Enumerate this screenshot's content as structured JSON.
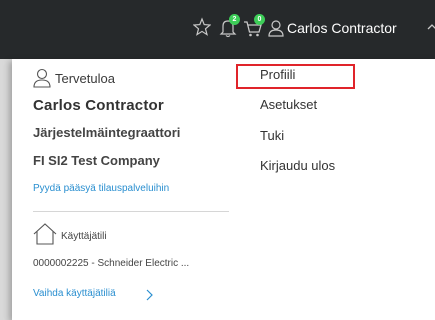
{
  "header": {
    "user_name": "Carlos Contractor",
    "notification_count": "2",
    "cart_count": "0",
    "icons": [
      "star-icon",
      "bell-icon",
      "cart-icon",
      "user-icon",
      "chevron-up-icon"
    ],
    "accent": "#3dcd58"
  },
  "profile": {
    "greeting": "Tervetuloa",
    "name": "Carlos Contractor",
    "role": "Järjestelmäintegraattori",
    "company": "FI SI2 Test Company",
    "request_link": "Pyydä pääsyä tilauspalveluihin",
    "account_label": "Käyttäjätili",
    "account_value": "0000002225 - Schneider Electric ...",
    "switch_link": "Vaihda käyttäjätiliä"
  },
  "menu": {
    "items": [
      {
        "label": "Profiili"
      },
      {
        "label": "Asetukset"
      },
      {
        "label": "Tuki"
      },
      {
        "label": "Kirjaudu ulos"
      }
    ]
  },
  "colors": {
    "topbar": "#26292b",
    "link": "#2a8fd0",
    "highlight": "#e0242a"
  }
}
